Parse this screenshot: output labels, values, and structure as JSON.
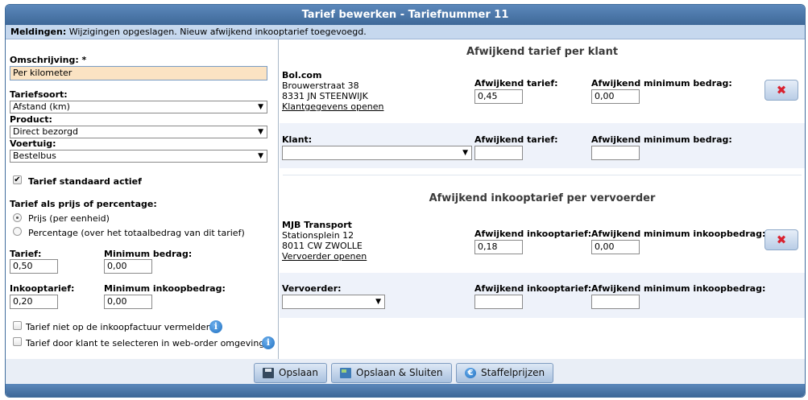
{
  "window": {
    "title": "Tarief bewerken - Tariefnummer 11"
  },
  "messages": {
    "label": "Meldingen:",
    "text": "Wijzigingen opgeslagen. Nieuw afwijkend inkooptarief toegevoegd."
  },
  "left": {
    "description_label": "Omschrijving: *",
    "description_value": "Per kilometer",
    "tariff_type_label": "Tariefsoort:",
    "tariff_type_value": "Afstand (km)",
    "product_label": "Product:",
    "product_value": "Direct bezorgd",
    "vehicle_label": "Voertuig:",
    "vehicle_value": "Bestelbus",
    "default_active_label": "Tarief standaard actief",
    "price_or_percentage_label": "Tarief als prijs of percentage:",
    "radio_price_label": "Prijs (per eenheid)",
    "radio_percentage_label": "Percentage (over het totaalbedrag van dit tarief)",
    "tariff_label": "Tarief:",
    "tariff_value": "0,50",
    "min_amount_label": "Minimum bedrag:",
    "min_amount_value": "0,00",
    "purchase_tariff_label": "Inkooptarief:",
    "purchase_tariff_value": "0,20",
    "min_purchase_label": "Minimum inkoopbedrag:",
    "min_purchase_value": "0,00",
    "not_on_invoice_label": "Tarief niet op de inkoopfactuur vermelden",
    "client_select_label": "Tarief door klant te selecteren in web-order omgeving"
  },
  "customer_section": {
    "title": "Afwijkend tarief per klant",
    "entry": {
      "name": "Bol.com",
      "street": "Brouwerstraat 38",
      "city": "8331 JN STEENWIJK",
      "link": "Klantgegevens openen",
      "rate_label": "Afwijkend tarief:",
      "rate_value": "0,45",
      "min_label": "Afwijkend minimum bedrag:",
      "min_value": "0,00"
    },
    "new": {
      "client_label": "Klant:",
      "rate_label": "Afwijkend tarief:",
      "min_label": "Afwijkend minimum bedrag:"
    }
  },
  "carrier_section": {
    "title": "Afwijkend inkooptarief per vervoerder",
    "entry": {
      "name": "MJB Transport",
      "street": "Stationsplein 12",
      "city": "8011 CW ZWOLLE",
      "link": "Vervoerder openen",
      "rate_label": "Afwijkend inkooptarief:",
      "rate_value": "0,18",
      "min_label": "Afwijkend minimum inkoopbedrag:",
      "min_value": "0,00"
    },
    "new": {
      "carrier_label": "Vervoerder:",
      "rate_label": "Afwijkend inkooptarief:",
      "min_label": "Afwijkend minimum inkoopbedrag:"
    }
  },
  "footer": {
    "save": "Opslaan",
    "save_close": "Opslaan & Sluiten",
    "scale_prices": "Staffelprijzen"
  },
  "icons": {
    "delete": "delete-x-icon",
    "info": "info-icon",
    "save": "floppy-disk-icon",
    "euro": "euro-icon"
  },
  "colors": {
    "title_bar": "#4a76a8",
    "message_bar": "#c6d8ee",
    "highlight_input": "#fbe3c3",
    "delete_x": "#d9212f"
  }
}
